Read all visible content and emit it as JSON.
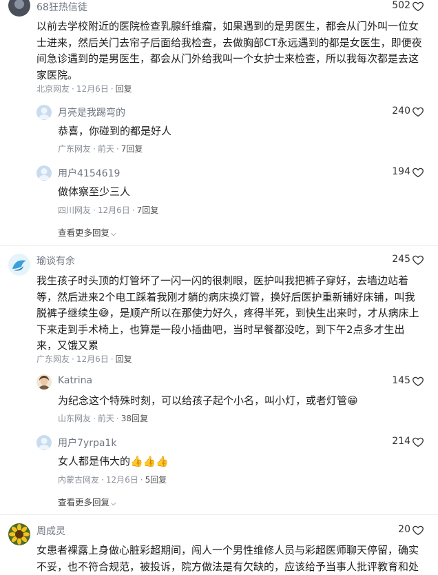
{
  "threads": [
    {
      "author": "68狂热信徒",
      "likes": "502",
      "lines": [
        "以前去学校附近的医院检查乳腺纤维瘤，如果遇到的是男医生，都会从门外叫一位女",
        "士进来，然后关门去帘子后面给我检查，去做胸部CT永远遇到的都是女医生，即便夜",
        "间急诊遇到的是男医生，都会从门外给我叫一个女护士来检查，所以我每次都是去这",
        "家医院。"
      ],
      "location": "北京网友",
      "date": "12月6日",
      "reply_label": "回复",
      "replies": [
        {
          "author": "月亮是我踢弯的",
          "likes": "240",
          "text": "恭喜，你碰到的都是好人",
          "location": "广东网友",
          "date": "前天",
          "reply_count": "7回复"
        },
        {
          "author": "用户4154619",
          "likes": "194",
          "text": "做体察至少三人",
          "location": "四川网友",
          "date": "12月6日",
          "reply_count": "7回复"
        }
      ],
      "more_label": "查看更多回复"
    },
    {
      "author": "瑜谈有余",
      "likes": "245",
      "lines": [
        "我生孩子时头顶的灯管坏了一闪一闪的很刺眼，医护叫我把裤子穿好，去墙边站着",
        "等，然后进来2个电工踩着我刚才躺的病床换灯管，换好后医护重新铺好床铺，叫我",
        "脱裤子继续生😅，是顺产所以在那使力好久，疼得半死，到快生出来时，才从病床上",
        "下来走到手术椅上，也算是一段小插曲吧，当时早餐都没吃，到下午2点多才生出",
        "来，又饿又累"
      ],
      "location": "广东网友",
      "date": "12月6日",
      "reply_label": "回复",
      "replies": [
        {
          "author": "Katrina",
          "likes": "145",
          "text": "为纪念这个特殊时刻，可以给孩子起个小名，叫小灯，或者灯管😁",
          "location": "山东网友",
          "date": "前天",
          "reply_count": "38回复"
        },
        {
          "author": "用户7yrpa1k",
          "likes": "214",
          "text": "女人都是伟大的👍👍👍",
          "location": "内蒙古网友",
          "date": "12月6日",
          "reply_count": "5回复"
        }
      ],
      "more_label": "查看更多回复"
    },
    {
      "author": "周成灵",
      "likes": "20",
      "lines": [
        "女患者裸露上身做心脏彩超期间，闯人一个男性维修人员与彩超医师聊天停留，确实",
        "不妥，也不符合规范，被投诉，院方做法是有欠缺的，应该给予当事人批评教育和处"
      ]
    }
  ],
  "colors": {
    "text": "#1f1f1f",
    "meta": "#8a8f99",
    "username": "#6e7681",
    "default_avatar": "#c9dcef"
  }
}
